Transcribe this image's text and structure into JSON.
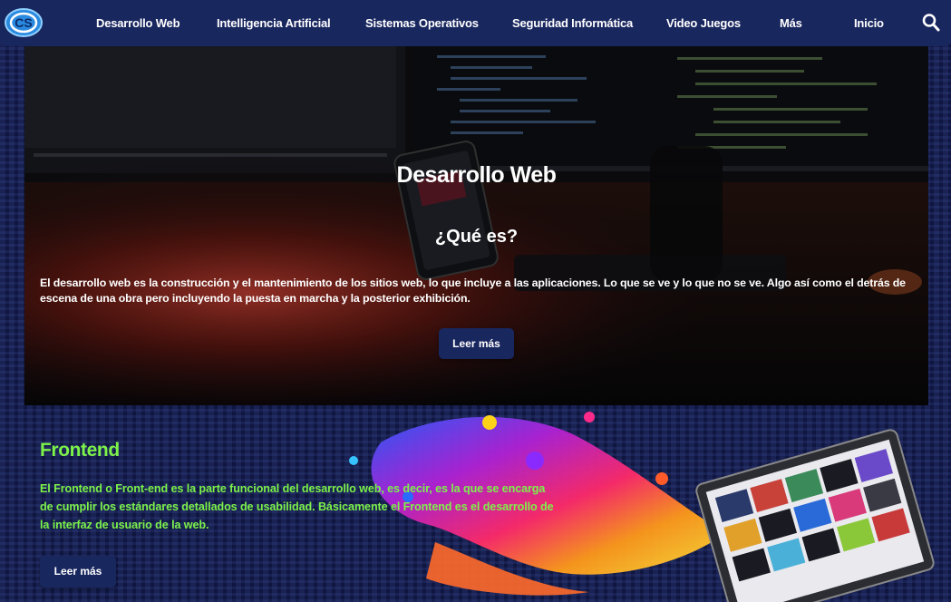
{
  "nav": {
    "logo_label": "CS",
    "items": [
      {
        "label": "Desarrollo Web"
      },
      {
        "label": "Intelligencia Artificial"
      },
      {
        "label": "Sistemas Operativos"
      },
      {
        "label": "Seguridad Informática"
      },
      {
        "label": "Video Juegos"
      },
      {
        "label": "Más"
      },
      {
        "label": "Inicio"
      }
    ],
    "search_icon": "search-icon"
  },
  "hero": {
    "title": "Desarrollo Web",
    "subtitle": "¿Qué es?",
    "text": "El desarrollo web es la construcción y el mantenimiento de los sitios web, lo que incluye a las aplicaciones. Lo que se ve y lo que no se ve. Algo así como el detrás de escena de una obra pero incluyendo la puesta en marcha y la posterior exhibición.",
    "button_label": "Leer más"
  },
  "frontend": {
    "title": "Frontend",
    "text": "El Frontend o Front-end es la parte funcional del desarrollo web, es decir, es la que se encarga de cumplir los estándares detallados de usabilidad. Básicamente el Frontend es el desarrollo de la interfaz de usuario de la web.",
    "button_label": "Leer más"
  },
  "colors": {
    "nav_bg": "#19275f",
    "page_bg": "#0f1640",
    "accent_green": "#7cf24a",
    "button_bg": "#19275f"
  }
}
